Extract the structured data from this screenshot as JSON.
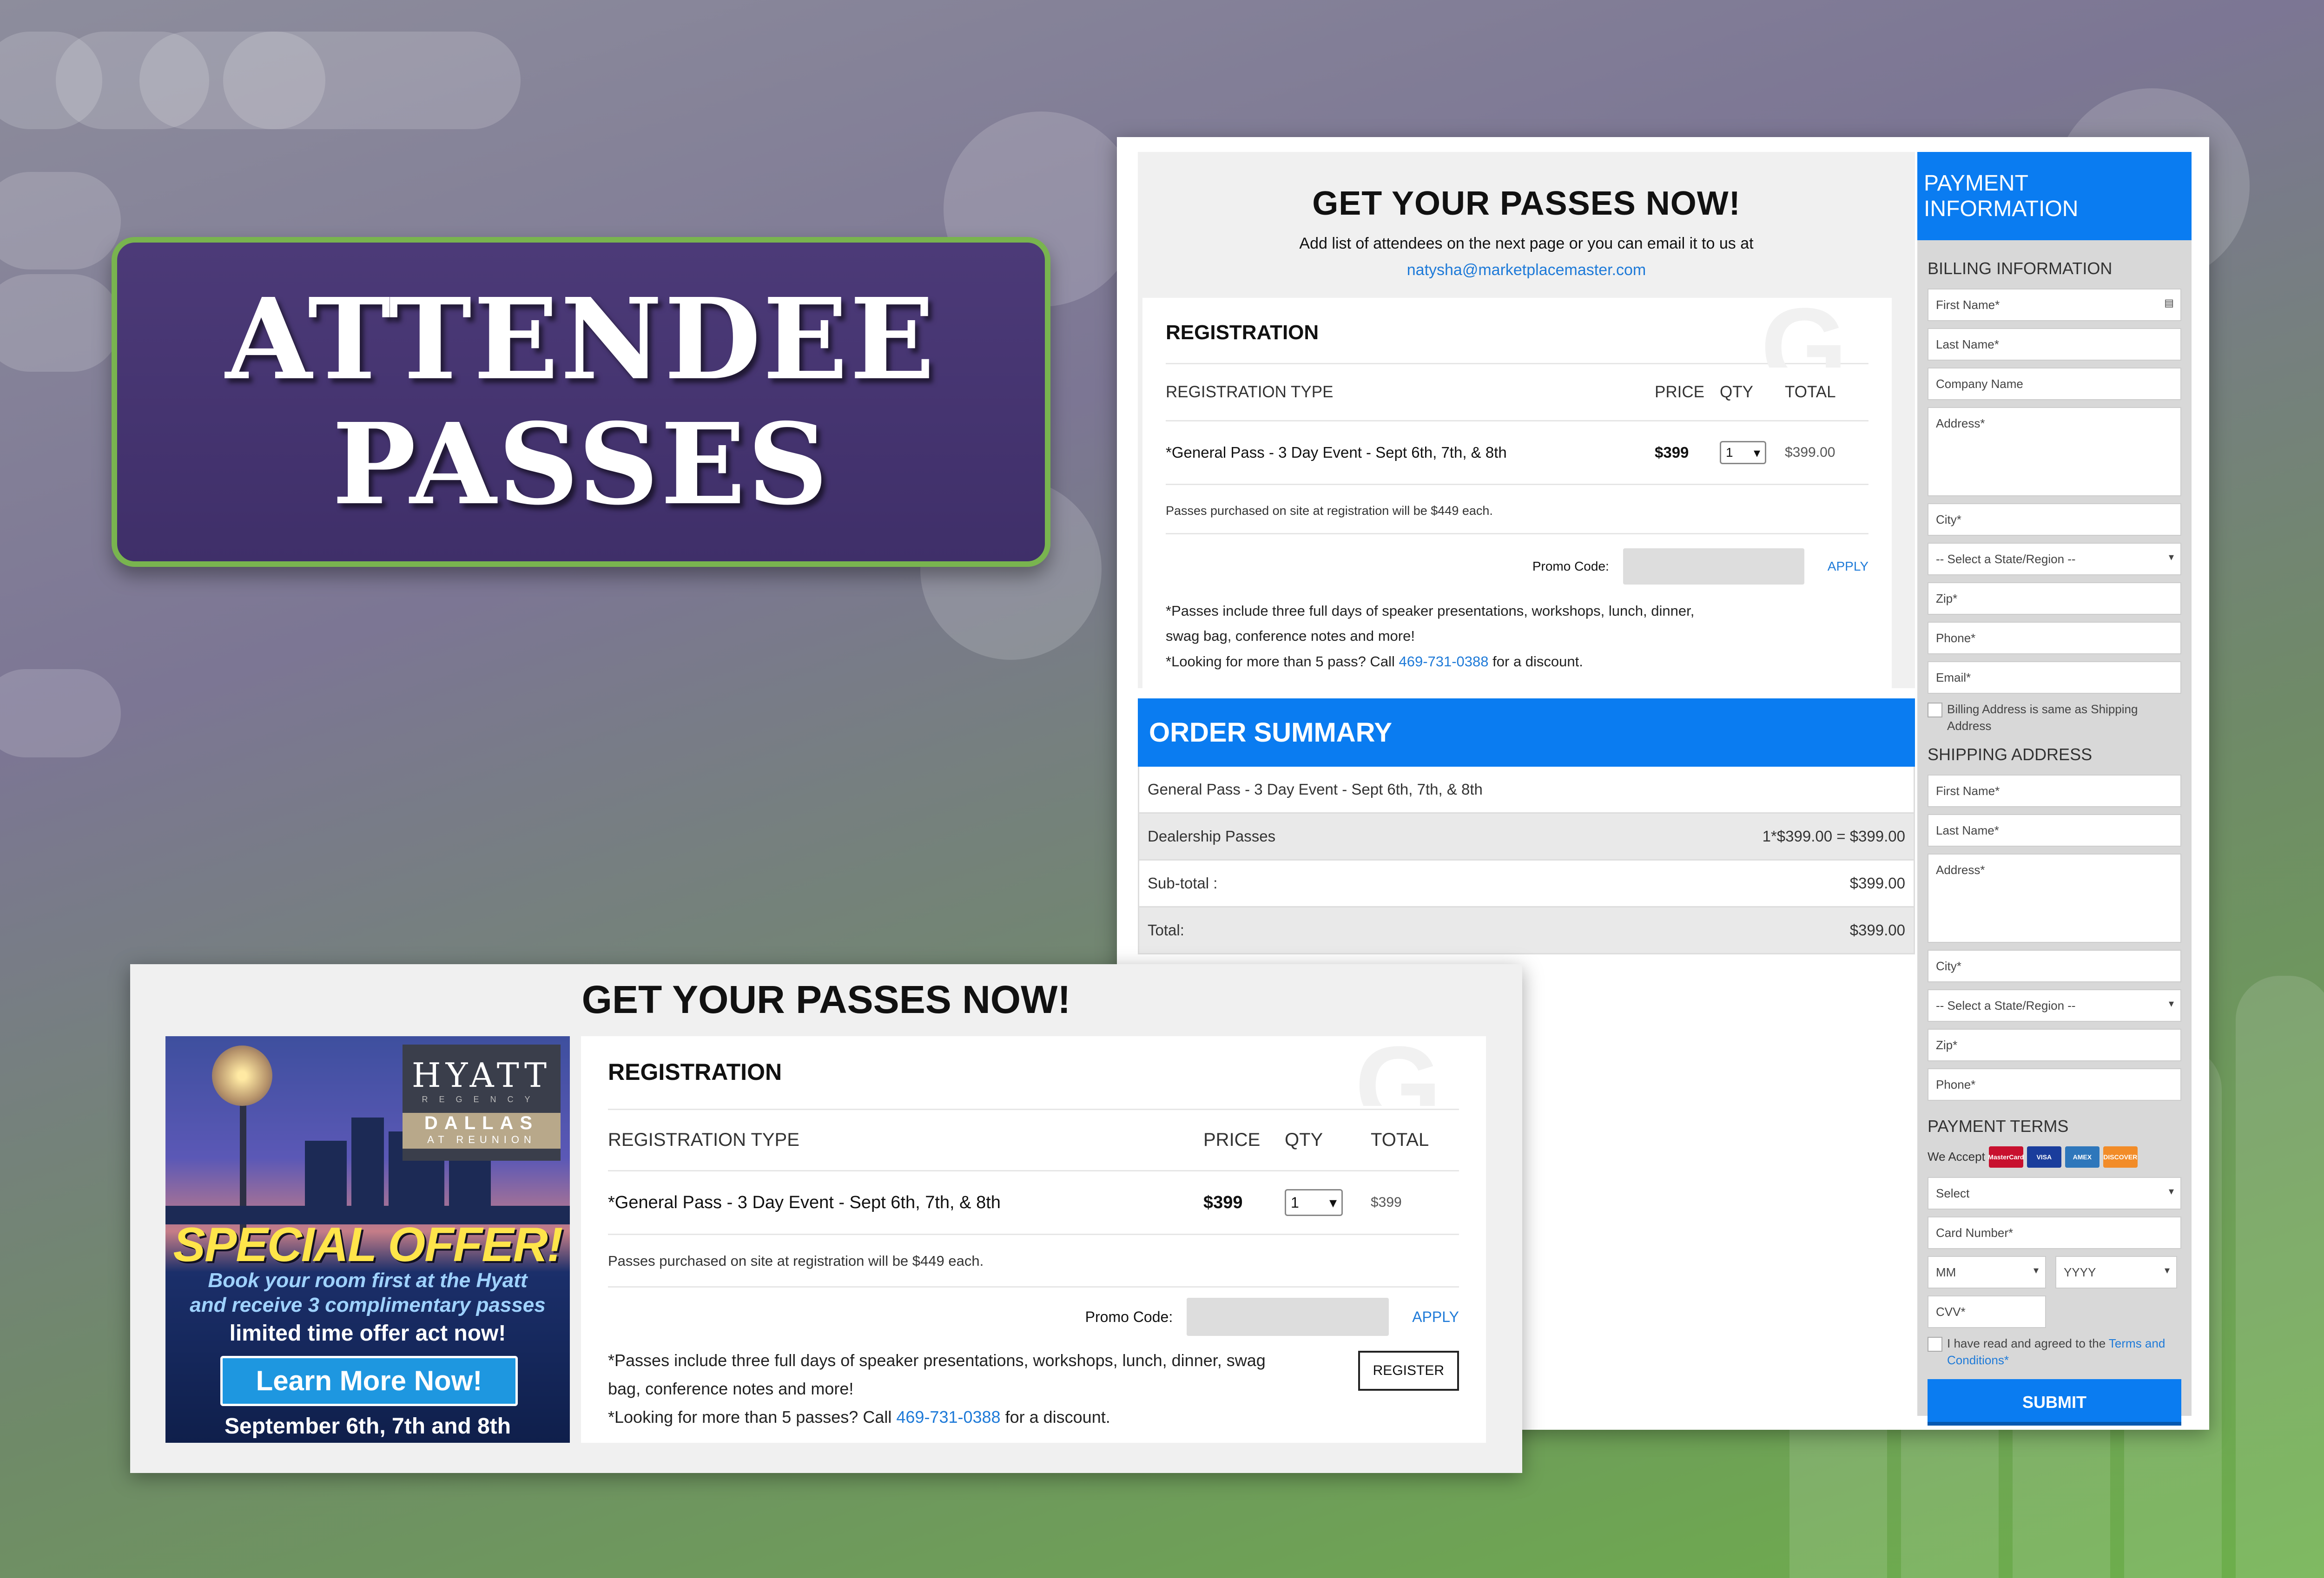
{
  "title_card": {
    "line1": "ATTENDEE",
    "line2": "PASSES"
  },
  "main": {
    "heading": "GET YOUR PASSES NOW!",
    "subtext": "Add list of attendees on the next page or you can email it to us at",
    "email": "natysha@marketplacemaster.com",
    "registration": {
      "title": "REGISTRATION",
      "columns": [
        "REGISTRATION TYPE",
        "PRICE",
        "QTY",
        "TOTAL"
      ],
      "item": "*General Pass - 3 Day Event - Sept 6th, 7th, & 8th",
      "price": "$399",
      "qty": "1",
      "total": "$399.00",
      "onsite_note": "Passes purchased on site at registration will be $449 each.",
      "promo_label": "Promo Code:",
      "apply": "APPLY",
      "fine1": "*Passes include three full days of speaker presentations, workshops, lunch, dinner,",
      "fine2": "swag bag, conference notes and more!",
      "fine3_pre": "*Looking for more than 5 pass? Call",
      "phone": "469-731-0388",
      "fine3_post": "for a discount."
    },
    "order_summary": {
      "title": "ORDER SUMMARY",
      "item": "General Pass - 3 Day Event - Sept 6th, 7th, & 8th",
      "dealership_label": "Dealership Passes",
      "dealership_value": "1*$399.00 = $399.00",
      "subtotal_label": "Sub-total :",
      "subtotal_value": "$399.00",
      "total_label": "Total:",
      "total_value": "$399.00"
    }
  },
  "payment": {
    "title": "PAYMENT INFORMATION",
    "billing_title": "BILLING INFORMATION",
    "billing_fields": [
      "First Name*",
      "Last Name*",
      "Company Name",
      "Address*",
      "City*",
      "-- Select a State/Region --",
      "Zip*",
      "Phone*",
      "Email*"
    ],
    "same_as_shipping": "Billing Address is same as Shipping Address",
    "shipping_title": "SHIPPING ADDRESS",
    "shipping_fields": [
      "First Name*",
      "Last Name*",
      "Address*",
      "City*",
      "-- Select a State/Region --",
      "Zip*",
      "Phone*"
    ],
    "terms_title": "PAYMENT TERMS",
    "we_accept": "We Accept",
    "card_brands": [
      "MasterCard",
      "VISA",
      "AMEX",
      "DISCOVER"
    ],
    "select": "Select",
    "card_number": "Card Number*",
    "mm": "MM",
    "yyyy": "YYYY",
    "cvv": "CVV*",
    "agree_pre": "I have read and agreed to the",
    "agree_link": "Terms and Conditions*",
    "submit": "SUBMIT"
  },
  "bottom": {
    "heading": "GET YOUR PASSES NOW!",
    "ad": {
      "brand": "HYATT",
      "brand_sub": "REGENCY",
      "city": "DALLAS",
      "location": "AT REUNION",
      "offer": "SPECIAL OFFER!",
      "offer_line1": "Book your room first at the Hyatt",
      "offer_line2": "and receive 3 complimentary passes",
      "limited": "limited time offer act now!",
      "cta": "Learn More Now!",
      "dates": "September 6th, 7th and 8th"
    },
    "registration": {
      "title": "REGISTRATION",
      "columns": [
        "REGISTRATION TYPE",
        "PRICE",
        "QTY",
        "TOTAL"
      ],
      "item": "*General Pass - 3 Day Event - Sept 6th, 7th, & 8th",
      "price": "$399",
      "qty": "1",
      "total": "$399",
      "onsite_note": "Passes purchased on site at registration will be $449 each.",
      "promo_label": "Promo Code:",
      "apply": "APPLY",
      "fine1": "*Passes include three full days of speaker presentations, workshops, lunch, dinner, swag",
      "fine2": "bag, conference notes and more!",
      "fine3_pre": "*Looking for more than 5 passes? Call",
      "phone": "469-731-0388",
      "fine3_post": "for a discount.",
      "register": "REGISTER"
    }
  }
}
